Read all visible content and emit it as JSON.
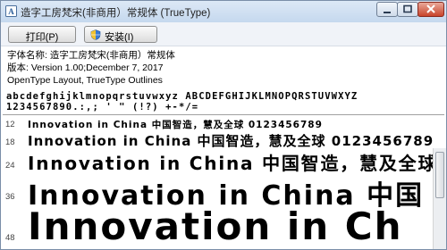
{
  "window": {
    "title": "造字工房梵宋(非商用）常规体 (TrueType)"
  },
  "toolbar": {
    "print_label": "打印(P)",
    "install_label": "安装(I)"
  },
  "info": {
    "font_name": "字体名称: 造字工房梵宋(非商用）常规体",
    "version": "版本: Version 1.00;December 7, 2017",
    "outline": "OpenType Layout, TrueType Outlines"
  },
  "charset": {
    "line1": "abcdefghijklmnopqrstuvwxyz ABCDEFGHIJKLMNOPQRSTUVWXYZ",
    "line2": "1234567890.:,; ' \" (!?) +-*/=",
    "sizes": [
      "12",
      "18",
      "24",
      "36",
      "48"
    ]
  },
  "samples": [
    "Innovation  in  China  中国智造，慧及全球  0123456789",
    "Innovation  in  China  中国智造，慧及全球  0123456789",
    "Innovation  in  China  中国智造，慧及全球",
    "Innovation  in  China  中国",
    "Innovation  in  Ch"
  ],
  "colors": {
    "title_bar": "#c5d8ee",
    "close_button": "#c8432a",
    "toolbar": "#f0f3f8"
  },
  "icons": {
    "app": "font-icon",
    "install": "shield-icon"
  }
}
